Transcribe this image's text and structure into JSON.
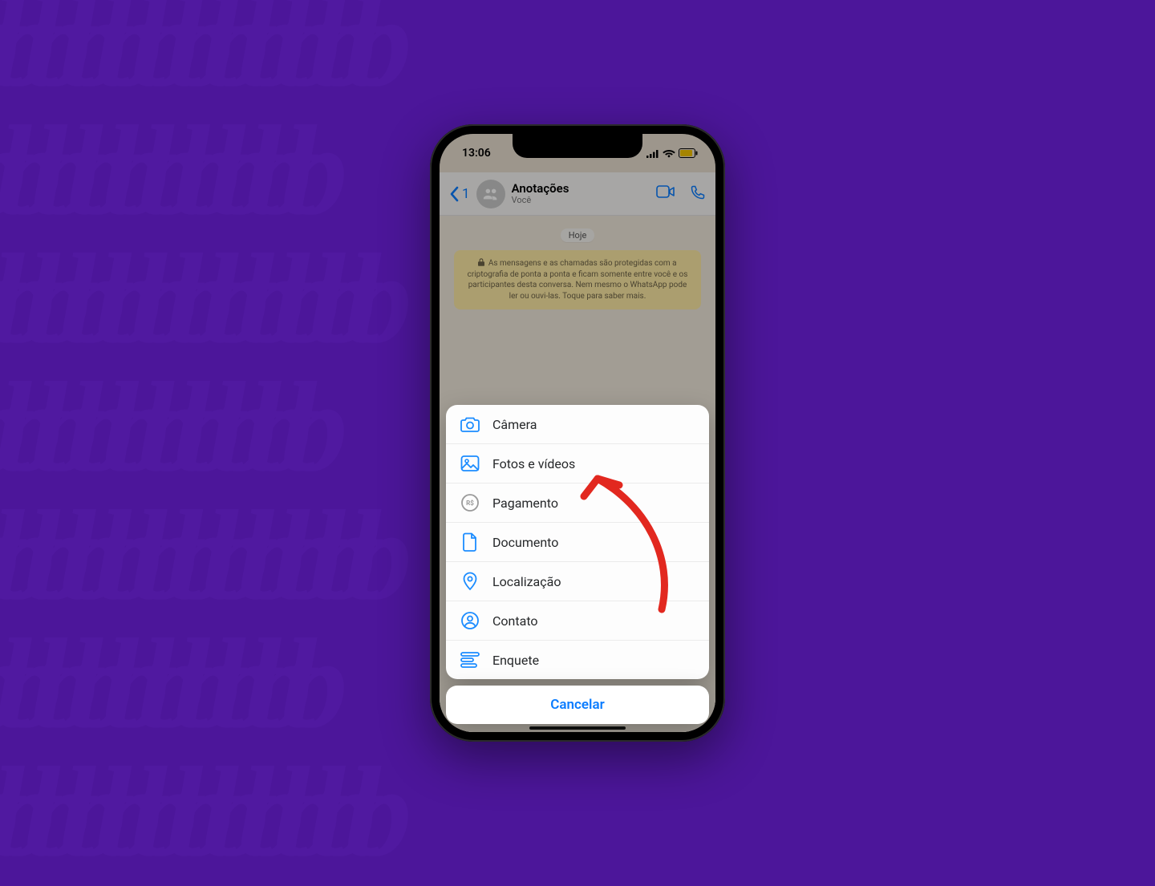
{
  "status": {
    "time": "13:06"
  },
  "header": {
    "back_count": "1",
    "title": "Anotações",
    "subtitle": "Você"
  },
  "chat": {
    "date_label": "Hoje",
    "encryption_note": "As mensagens e as chamadas são protegidas com a criptografia de ponta a ponta e ficam somente entre você e os participantes desta conversa. Nem mesmo o WhatsApp pode ler ou ouvi-las. Toque para saber mais."
  },
  "sheet": {
    "items": {
      "camera": "Câmera",
      "photos": "Fotos e vídeos",
      "payment": "Pagamento",
      "document": "Documento",
      "location": "Localização",
      "contact": "Contato",
      "poll": "Enquete"
    },
    "cancel": "Cancelar"
  },
  "colors": {
    "accent": "#0a7cff",
    "icon_blue": "#1b8cff",
    "icon_grey": "#9a9a9a",
    "annotation_red": "#e2281f"
  }
}
